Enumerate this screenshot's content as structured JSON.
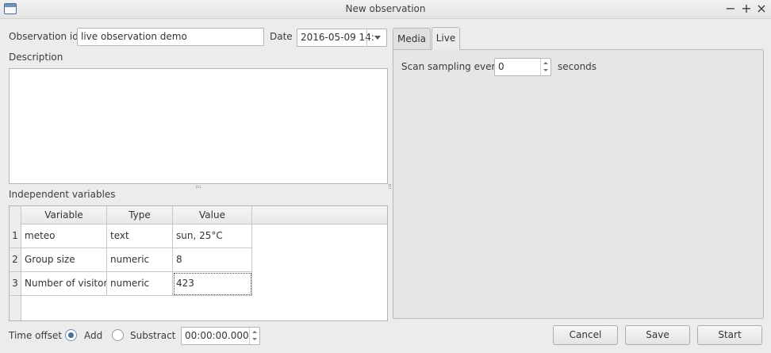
{
  "window": {
    "title": "New observation",
    "controls": {
      "minimize": "−",
      "maximize": "+",
      "close": "×"
    }
  },
  "form": {
    "observation_id_label": "Observation id",
    "observation_id_value": "live observation demo",
    "date_label": "Date",
    "date_value": "2016-05-09 14:",
    "description_label": "Description",
    "description_value": ""
  },
  "independent_variables": {
    "label": "Independent variables",
    "columns": [
      "Variable",
      "Type",
      "Value"
    ],
    "rows": [
      {
        "num": "1",
        "variable": "meteo",
        "type": "text",
        "value": "sun, 25°C"
      },
      {
        "num": "2",
        "variable": "Group size",
        "type": "numeric",
        "value": "8"
      },
      {
        "num": "3",
        "variable": "Number of visitors",
        "type": "numeric",
        "value": "423"
      }
    ]
  },
  "tabs": [
    {
      "label": "Media",
      "active": false
    },
    {
      "label": "Live",
      "active": true
    }
  ],
  "live": {
    "scan_label": "Scan sampling every",
    "scan_value": "0",
    "seconds_label": "seconds"
  },
  "time_offset": {
    "label": "Time offset",
    "add_label": "Add",
    "subtract_label": "Substract",
    "selected": "add",
    "value": "00:00:00.000"
  },
  "buttons": {
    "cancel": "Cancel",
    "save": "Save",
    "start": "Start"
  }
}
